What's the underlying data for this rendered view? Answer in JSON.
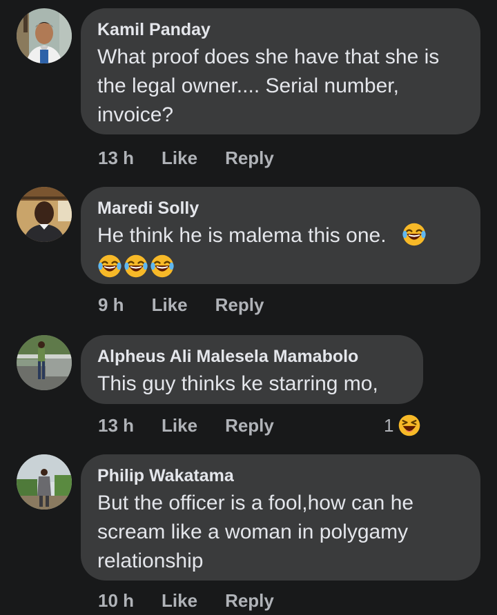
{
  "comments": [
    {
      "author": "Kamil Panday",
      "text": "What proof does she have that she is the legal owner.... Serial number, invoice?",
      "time": "13 h",
      "like_label": "Like",
      "reply_label": "Reply"
    },
    {
      "author": "Maredi Solly",
      "text": "He think he is malema this one.",
      "emoji": "laughing-tears-emoji",
      "time": "9 h",
      "like_label": "Like",
      "reply_label": "Reply"
    },
    {
      "author": "Alpheus Ali Malesela Mamabolo",
      "text": "This guy thinks ke starring mo,",
      "time": "13 h",
      "like_label": "Like",
      "reply_label": "Reply",
      "reaction_count": "1",
      "reaction_icon": "haha-reaction-icon"
    },
    {
      "author": "Philip Wakatama",
      "text": "But the officer is a fool,how can he scream like a woman in polygamy relationship",
      "time": "10 h",
      "like_label": "Like",
      "reply_label": "Reply"
    }
  ],
  "colors": {
    "background": "#18191a",
    "bubble": "#3a3b3c",
    "primary_text": "#e4e6eb",
    "secondary_text": "#b0b3b8"
  }
}
